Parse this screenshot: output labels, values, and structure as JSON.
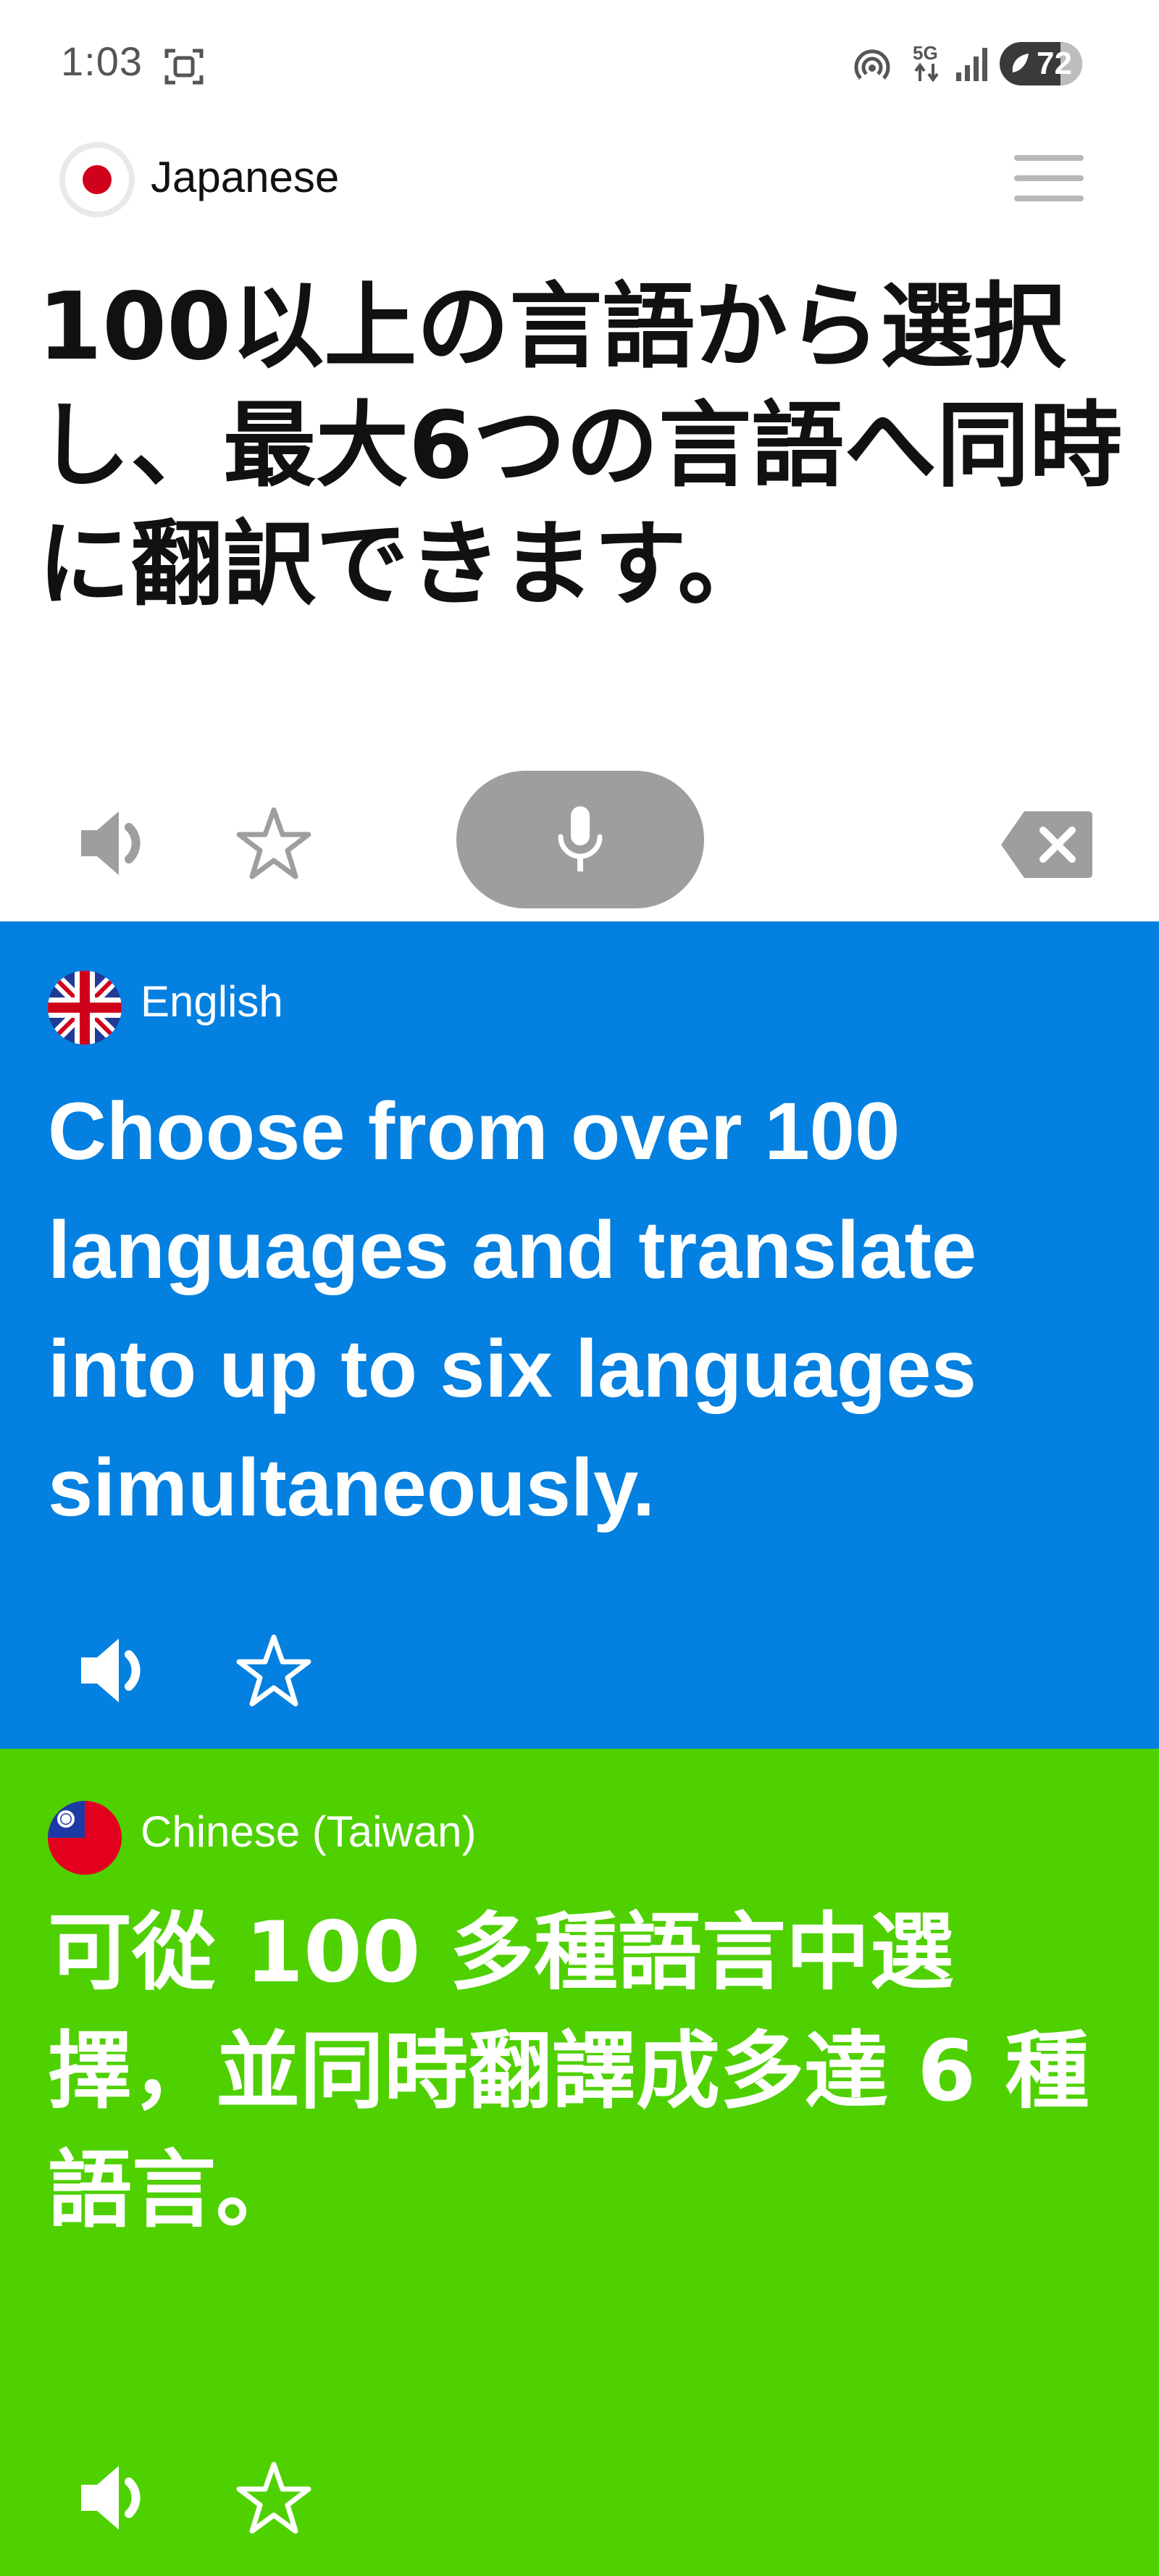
{
  "status_bar": {
    "time": "1:03",
    "network": "5G",
    "battery": "72"
  },
  "source": {
    "language": "Japanese",
    "text": "100以上の言語から選択し、最大6つの言語へ同時に翻訳できます。"
  },
  "translations": [
    {
      "language": "English",
      "text": "Choose from over 100 languages and translate into up to six languages simultaneously.",
      "background": "#0380e0"
    },
    {
      "language": "Chinese (Taiwan)",
      "text": "可從 100 多種語言中選擇，並同時翻譯成多達 6 種語言。",
      "background": "#4fd000"
    }
  ],
  "icons": {
    "speaker": "speaker-icon",
    "favorite": "star-icon",
    "microphone": "microphone-icon",
    "clear": "backspace-icon",
    "menu": "hamburger-menu-icon"
  },
  "colors": {
    "mic_button": "#9e9e9e",
    "icon_gray": "#9e9e9e"
  }
}
